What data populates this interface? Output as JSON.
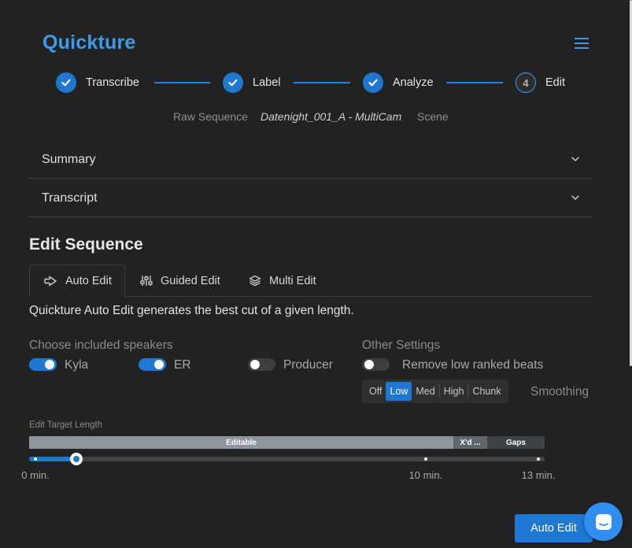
{
  "app": {
    "title": "Quickture"
  },
  "stepper": {
    "steps": [
      {
        "label": "Transcribe",
        "state": "done"
      },
      {
        "label": "Label",
        "state": "done"
      },
      {
        "label": "Analyze",
        "state": "done"
      },
      {
        "label": "Edit",
        "state": "current",
        "number": "4"
      }
    ]
  },
  "breadcrumb": {
    "items": [
      "Raw Sequence",
      "Datenight_001_A - MultiCam",
      "Scene"
    ]
  },
  "accordions": [
    "Summary",
    "Transcript"
  ],
  "edit_sequence": {
    "title": "Edit Sequence",
    "tabs": [
      {
        "label": "Auto Edit",
        "icon": "arrow-right-icon",
        "active": true
      },
      {
        "label": "Guided Edit",
        "icon": "sliders-icon",
        "active": false
      },
      {
        "label": "Multi Edit",
        "icon": "layers-icon",
        "active": false
      }
    ],
    "description": "Quickture Auto Edit generates the best cut of a given length.",
    "speakers": {
      "title": "Choose included speakers",
      "items": [
        {
          "label": "Kyla",
          "on": true
        },
        {
          "label": "ER",
          "on": true
        },
        {
          "label": "Producer",
          "on": false
        }
      ]
    },
    "other_settings": {
      "title": "Other Settings",
      "remove_low_ranked": {
        "label": "Remove low ranked beats",
        "on": false
      },
      "smoothing": {
        "label": "Smoothing",
        "options": [
          "Off",
          "Low",
          "Med",
          "High",
          "Chunk"
        ],
        "selected": "Low"
      }
    },
    "target_length": {
      "label": "Edit Target Length",
      "segments": [
        {
          "label": "Editable",
          "color": "#8e959c",
          "max_minutes": 10.7
        },
        {
          "label": "X'd ...",
          "color": "#5f666c",
          "max_minutes": 11.55
        },
        {
          "label": "Gaps",
          "color": "#3d4246",
          "max_minutes": 13
        }
      ],
      "max_minutes": 13,
      "value_minutes": 1.2,
      "marks": [
        {
          "minutes": 0,
          "label": "0 min."
        },
        {
          "minutes": 10,
          "label": "10 min."
        },
        {
          "minutes": 13,
          "label": "13 min."
        }
      ]
    },
    "submit_label": "Auto Edit"
  },
  "colors": {
    "accent": "#3d9be9",
    "primary": "#1e78d2",
    "background": "#222222"
  }
}
